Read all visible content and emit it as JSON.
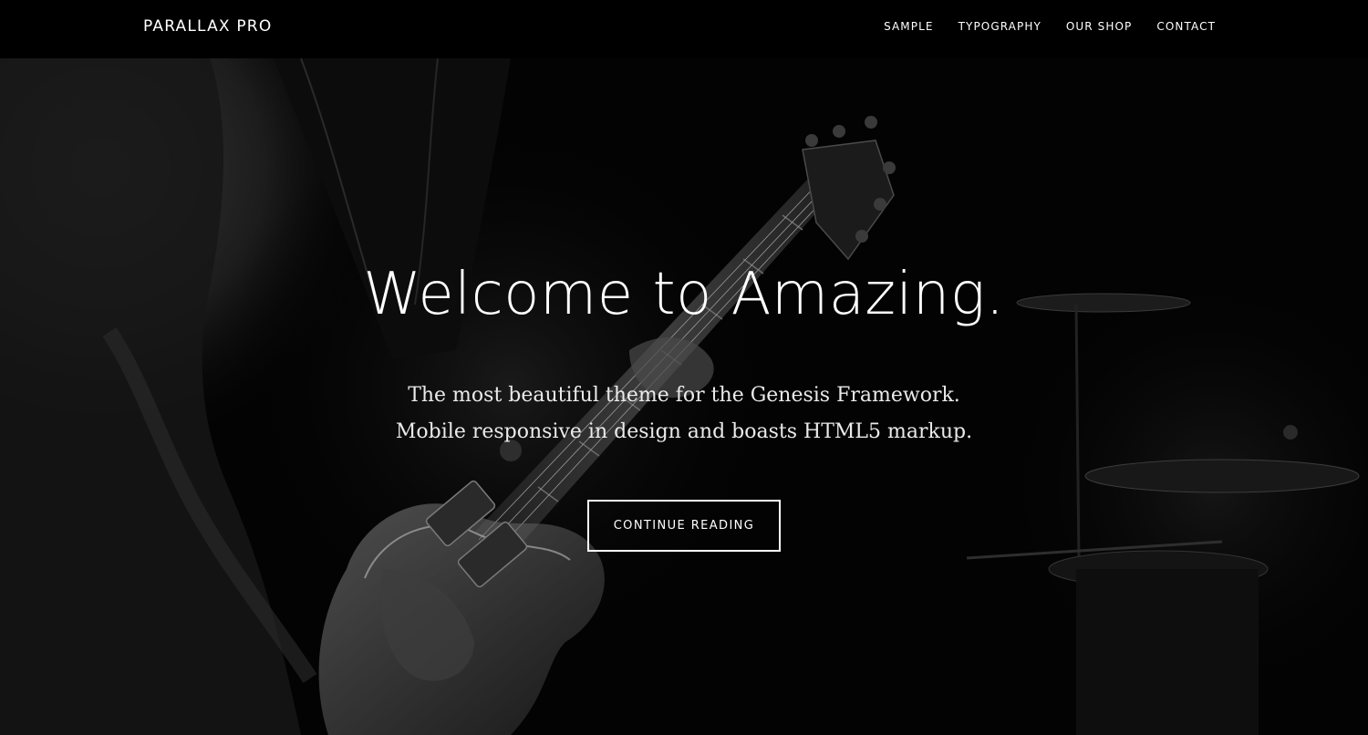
{
  "header": {
    "site_title": "PARALLAX PRO",
    "nav": [
      {
        "label": "SAMPLE"
      },
      {
        "label": "TYPOGRAPHY"
      },
      {
        "label": "OUR SHOP"
      },
      {
        "label": "CONTACT"
      }
    ]
  },
  "hero": {
    "title": "Welcome to Amazing.",
    "description_line1": "The most beautiful theme for the Genesis Framework.",
    "description_line2": "Mobile responsive in design and boasts HTML5 markup.",
    "cta_label": "CONTINUE READING",
    "background_icon": "guitarist-photo"
  },
  "colors": {
    "background": "#000000",
    "text": "#ffffff"
  }
}
